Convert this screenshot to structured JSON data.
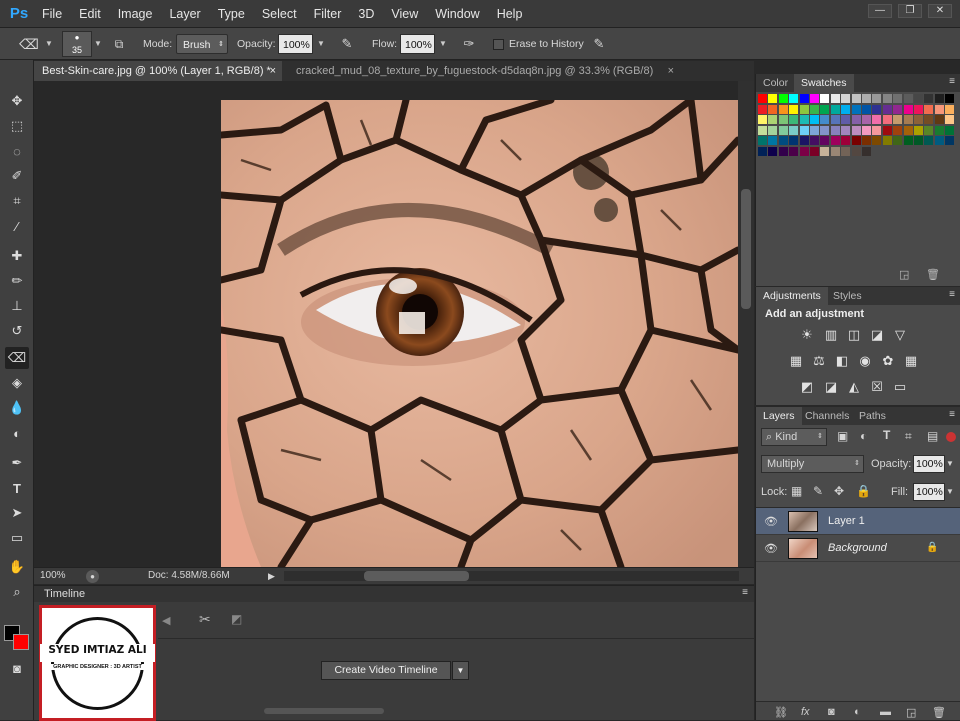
{
  "app": {
    "logo": "Ps"
  },
  "menu": [
    "File",
    "Edit",
    "Image",
    "Layer",
    "Type",
    "Select",
    "Filter",
    "3D",
    "View",
    "Window",
    "Help"
  ],
  "window_controls": {
    "minimize": "—",
    "restore": "❐",
    "close": "✕"
  },
  "options": {
    "brush_size": "35",
    "mode_label": "Mode:",
    "mode_value": "Brush",
    "opacity_label": "Opacity:",
    "opacity_value": "100%",
    "flow_label": "Flow:",
    "flow_value": "100%",
    "erase_history_label": "Erase to History"
  },
  "tabs": [
    {
      "label": "Best-Skin-care.jpg @ 100% (Layer 1, RGB/8) *",
      "close": "×"
    },
    {
      "label": "cracked_mud_08_texture_by_fuguestock-d5daq8n.jpg @ 33.3% (RGB/8)",
      "close": "×"
    }
  ],
  "status": {
    "zoom": "100%",
    "doc": "Doc: 4.58M/8.66M"
  },
  "timeline": {
    "tab_label": "Timeline",
    "create_button": "Create Video Timeline",
    "logo_name": "SYED IMTIAZ ALI",
    "logo_subtitle": "GRAPHIC DESIGNER : 3D ARTIST"
  },
  "swatches_panel": {
    "tabs": [
      "Color",
      "Swatches"
    ],
    "colors": [
      "#ff0000",
      "#ffff00",
      "#00ff00",
      "#00ffff",
      "#0000ff",
      "#ff00ff",
      "#ffffff",
      "#ebebeb",
      "#d6d6d6",
      "#c2c2c2",
      "#adadad",
      "#999999",
      "#858585",
      "#707070",
      "#5c5c5c",
      "#474747",
      "#333333",
      "#1f1f1f",
      "#000000",
      "#ed1c24",
      "#f26522",
      "#f7941d",
      "#fff200",
      "#8dc63f",
      "#39b54a",
      "#00a651",
      "#00a99d",
      "#00aeef",
      "#0072bc",
      "#0054a6",
      "#2e3192",
      "#662d91",
      "#92278f",
      "#ec008c",
      "#ed145b",
      "#f26c4f",
      "#f69679",
      "#fbaf5d",
      "#fff568",
      "#acd373",
      "#7cc576",
      "#3cb878",
      "#1cbbb4",
      "#00bff3",
      "#448ccb",
      "#5674b9",
      "#605ca8",
      "#8560a8",
      "#a864a8",
      "#f06eaa",
      "#f26d7d",
      "#c69c6d",
      "#a67c52",
      "#8c6239",
      "#754c24",
      "#603913",
      "#fdc689",
      "#c4df9b",
      "#a3d39c",
      "#82ca9c",
      "#7accc8",
      "#6dcff6",
      "#7da7d9",
      "#8393ca",
      "#8781bd",
      "#a186be",
      "#bd8cbf",
      "#f49ac1",
      "#f5989d",
      "#9e0b0f",
      "#a0410d",
      "#a36209",
      "#aba000",
      "#598527",
      "#197b30",
      "#007236",
      "#00746b",
      "#0076a3",
      "#004b80",
      "#003471",
      "#1b1464",
      "#440e62",
      "#630460",
      "#9e005d",
      "#9e0039",
      "#790000",
      "#7b2e00",
      "#7d4900",
      "#827b00",
      "#406618",
      "#005e20",
      "#005826",
      "#005952",
      "#005b7f",
      "#003663",
      "#002157",
      "#0d004c",
      "#32004b",
      "#4b0049",
      "#7b0046",
      "#7a0026",
      "#c7b299",
      "#998675",
      "#736357",
      "#534741",
      "#362f2d"
    ]
  },
  "adjustments_panel": {
    "tabs": [
      "Adjustments",
      "Styles"
    ],
    "heading": "Add an adjustment"
  },
  "layers_panel": {
    "tabs": [
      "Layers",
      "Channels",
      "Paths"
    ],
    "kind_label": "Kind",
    "blend_mode": "Multiply",
    "opacity_label": "Opacity:",
    "opacity_value": "100%",
    "lock_label": "Lock:",
    "fill_label": "Fill:",
    "fill_value": "100%",
    "layers": [
      {
        "name": "Layer 1",
        "selected": true
      },
      {
        "name": "Background",
        "selected": false
      }
    ],
    "footer_icons": [
      "link-icon",
      "fx-icon",
      "mask-icon",
      "adjustment-icon",
      "folder-icon",
      "new-layer-icon",
      "trash-icon"
    ]
  },
  "colors": {
    "foreground": "#000000",
    "background": "#ff0000",
    "accent": "#31a8ff",
    "selected_layer": "#55637a"
  }
}
